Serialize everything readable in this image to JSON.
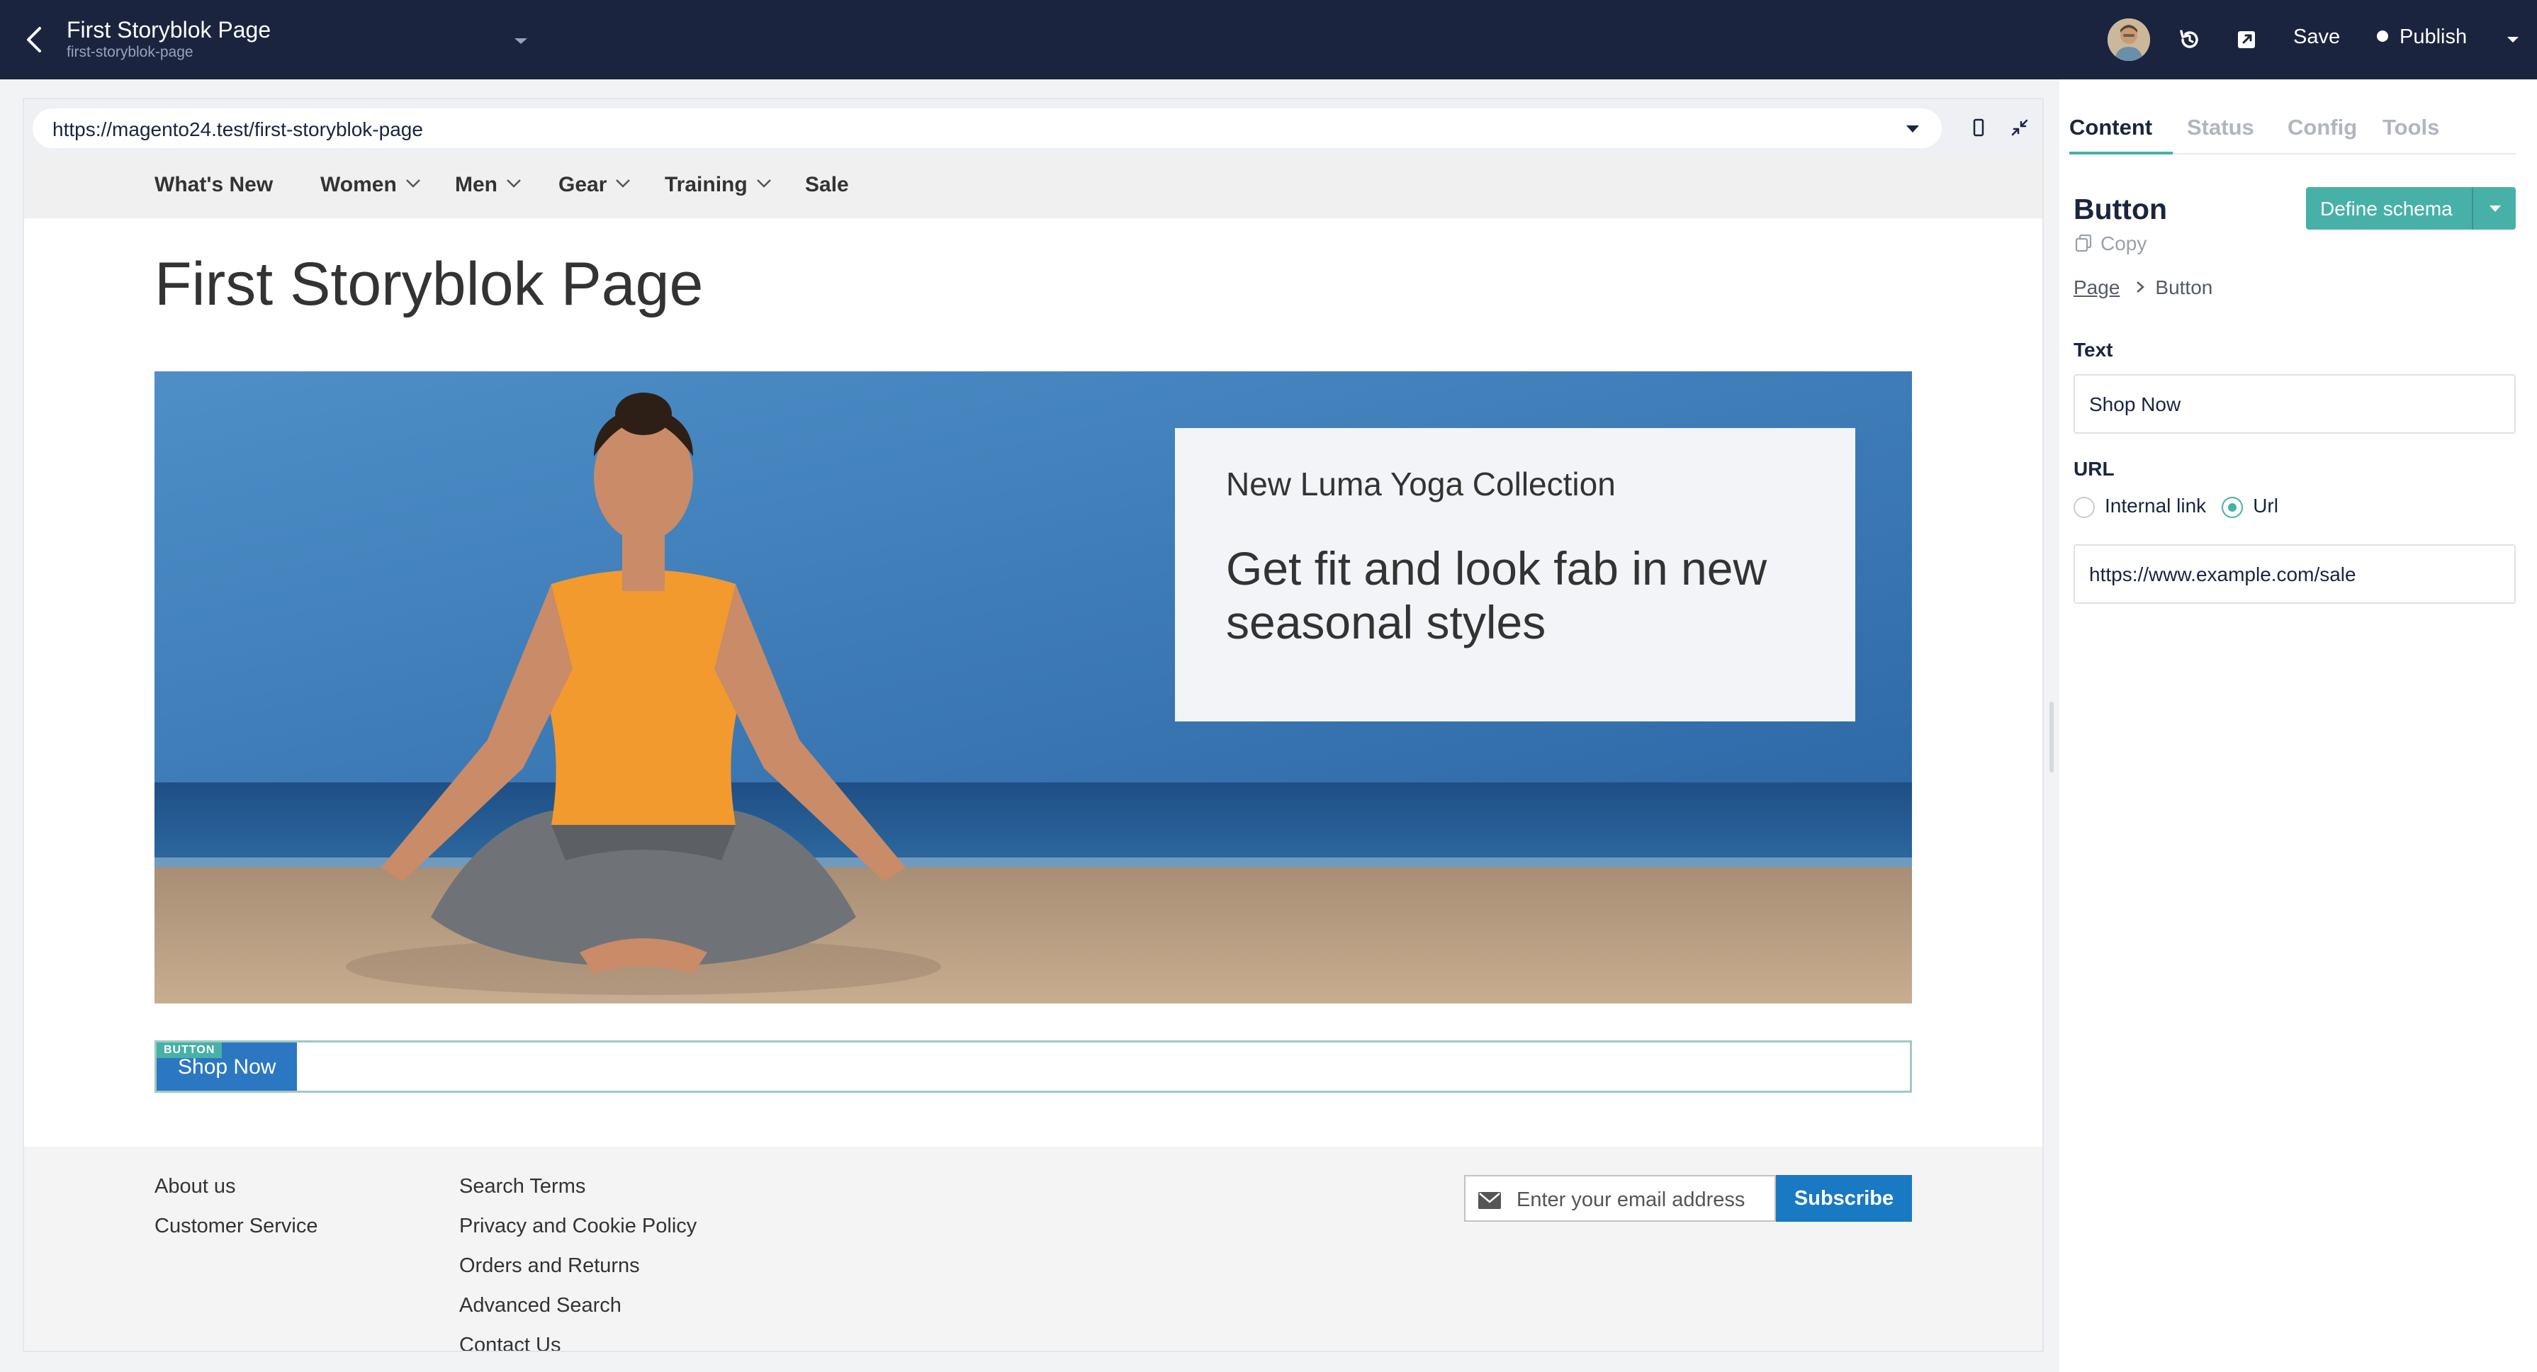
{
  "header": {
    "story_title": "First Storyblok Page",
    "story_slug": "first-storyblok-page",
    "save_label": "Save",
    "publish_label": "Publish"
  },
  "preview": {
    "url": "https://magento24.test/first-storyblok-page",
    "nav": [
      {
        "label": "What's New",
        "has_dropdown": false
      },
      {
        "label": "Women",
        "has_dropdown": true
      },
      {
        "label": "Men",
        "has_dropdown": true
      },
      {
        "label": "Gear",
        "has_dropdown": true
      },
      {
        "label": "Training",
        "has_dropdown": true
      },
      {
        "label": "Sale",
        "has_dropdown": false
      }
    ],
    "page_title": "First Storyblok Page",
    "hero": {
      "subtitle": "New Luma Yoga Collection",
      "headline": "Get fit and look fab in new seasonal styles"
    },
    "button_block": {
      "tag": "BUTTON",
      "label": "Shop Now"
    },
    "footer": {
      "col1": [
        "About us",
        "Customer Service"
      ],
      "col2": [
        "Search Terms",
        "Privacy and Cookie Policy",
        "Orders and Returns",
        "Advanced Search",
        "Contact Us"
      ],
      "email_placeholder": "Enter your email address",
      "subscribe_label": "Subscribe"
    }
  },
  "panel": {
    "tabs": [
      "Content",
      "Status",
      "Config",
      "Tools"
    ],
    "active_tab": "Content",
    "component_title": "Button",
    "copy_label": "Copy",
    "define_schema_label": "Define schema",
    "breadcrumb": {
      "parent": "Page",
      "current": "Button"
    },
    "text_field": {
      "label": "Text",
      "value": "Shop Now"
    },
    "url_field": {
      "label": "URL",
      "options": [
        "Internal link",
        "Url"
      ],
      "selected": "Url",
      "value": "https://www.example.com/sale"
    }
  },
  "colors": {
    "topbar": "#1b243f",
    "accent": "#48b1a7",
    "shop_button": "#2b77c2",
    "subscribe": "#1979c3"
  }
}
